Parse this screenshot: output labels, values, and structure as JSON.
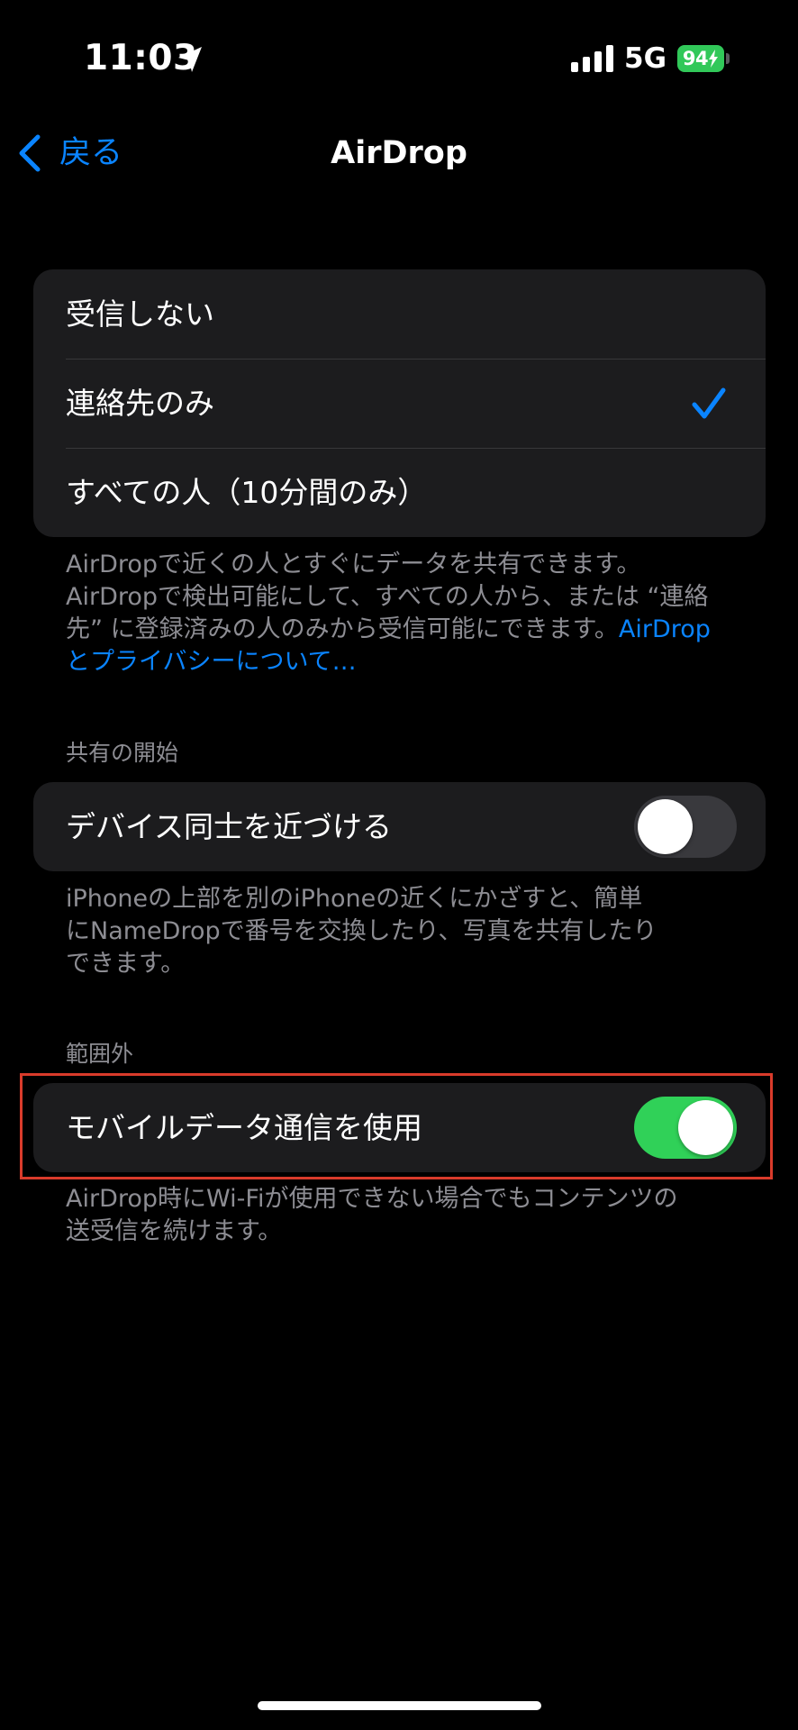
{
  "status_bar": {
    "time": "11:03",
    "network": "5G",
    "battery": "94"
  },
  "nav": {
    "back_label": "戻る",
    "title": "AirDrop"
  },
  "receiving": {
    "options": [
      {
        "label": "受信しない",
        "selected": false
      },
      {
        "label": "連絡先のみ",
        "selected": true
      },
      {
        "label": "すべての人（10分間のみ）",
        "selected": false
      }
    ],
    "footer_line1": "AirDropで近くの人とすぐにデータを共有できます。",
    "footer_line2": "AirDropで検出可能にして、すべての人から、または “連絡",
    "footer_line3": "先” に登録済みの人のみから受信可能にできます。",
    "footer_link_part1": "AirDrop",
    "footer_link_part2": "とプライバシーについて…"
  },
  "start_sharing": {
    "header": "共有の開始",
    "bring_devices_label": "デバイス同士を近づける",
    "bring_devices_enabled": false,
    "footer_line1": "iPhoneの上部を別のiPhoneの近くにかざすと、簡単",
    "footer_line2": "にNameDropで番号を交換したり、写真を共有したり",
    "footer_line3": "できます。"
  },
  "out_of_range": {
    "header": "範囲外",
    "cellular_label": "モバイルデータ通信を使用",
    "cellular_enabled": true,
    "footer_line1": "AirDrop時にWi-Fiが使用できない場合でもコンテンツの",
    "footer_line2": "送受信を続けます。"
  },
  "colors": {
    "accent": "#0a84ff",
    "switch_on": "#30d158",
    "highlight": "#d93b2b",
    "battery": "#31c859"
  }
}
